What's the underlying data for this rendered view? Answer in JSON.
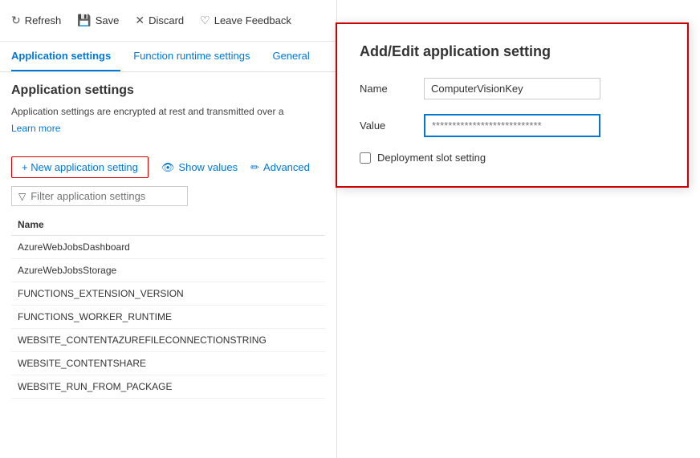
{
  "toolbar": {
    "refresh_label": "Refresh",
    "save_label": "Save",
    "discard_label": "Discard",
    "feedback_label": "Leave Feedback"
  },
  "nav": {
    "tabs": [
      {
        "id": "app-settings",
        "label": "Application settings",
        "active": true
      },
      {
        "id": "function-runtime",
        "label": "Function runtime settings",
        "active": false
      },
      {
        "id": "general",
        "label": "General",
        "active": false
      }
    ]
  },
  "main": {
    "section_title": "Application settings",
    "description": "Application settings are encrypted at rest and transmitted over a",
    "learn_more": "Learn more",
    "new_setting_label": "+ New application setting",
    "show_values_label": "Show values",
    "advanced_label": "Advanced",
    "filter_placeholder": "Filter application settings",
    "table": {
      "column_name": "Name",
      "rows": [
        "AzureWebJobsDashboard",
        "AzureWebJobsStorage",
        "FUNCTIONS_EXTENSION_VERSION",
        "FUNCTIONS_WORKER_RUNTIME",
        "WEBSITE_CONTENTAZUREFILECONNECTIONSTRING",
        "WEBSITE_CONTENTSHARE",
        "WEBSITE_RUN_FROM_PACKAGE"
      ]
    }
  },
  "dialog": {
    "title": "Add/Edit application setting",
    "name_label": "Name",
    "name_value": "ComputerVisionKey",
    "value_label": "Value",
    "value_placeholder": "***************************",
    "checkbox_label": "Deployment slot setting"
  }
}
